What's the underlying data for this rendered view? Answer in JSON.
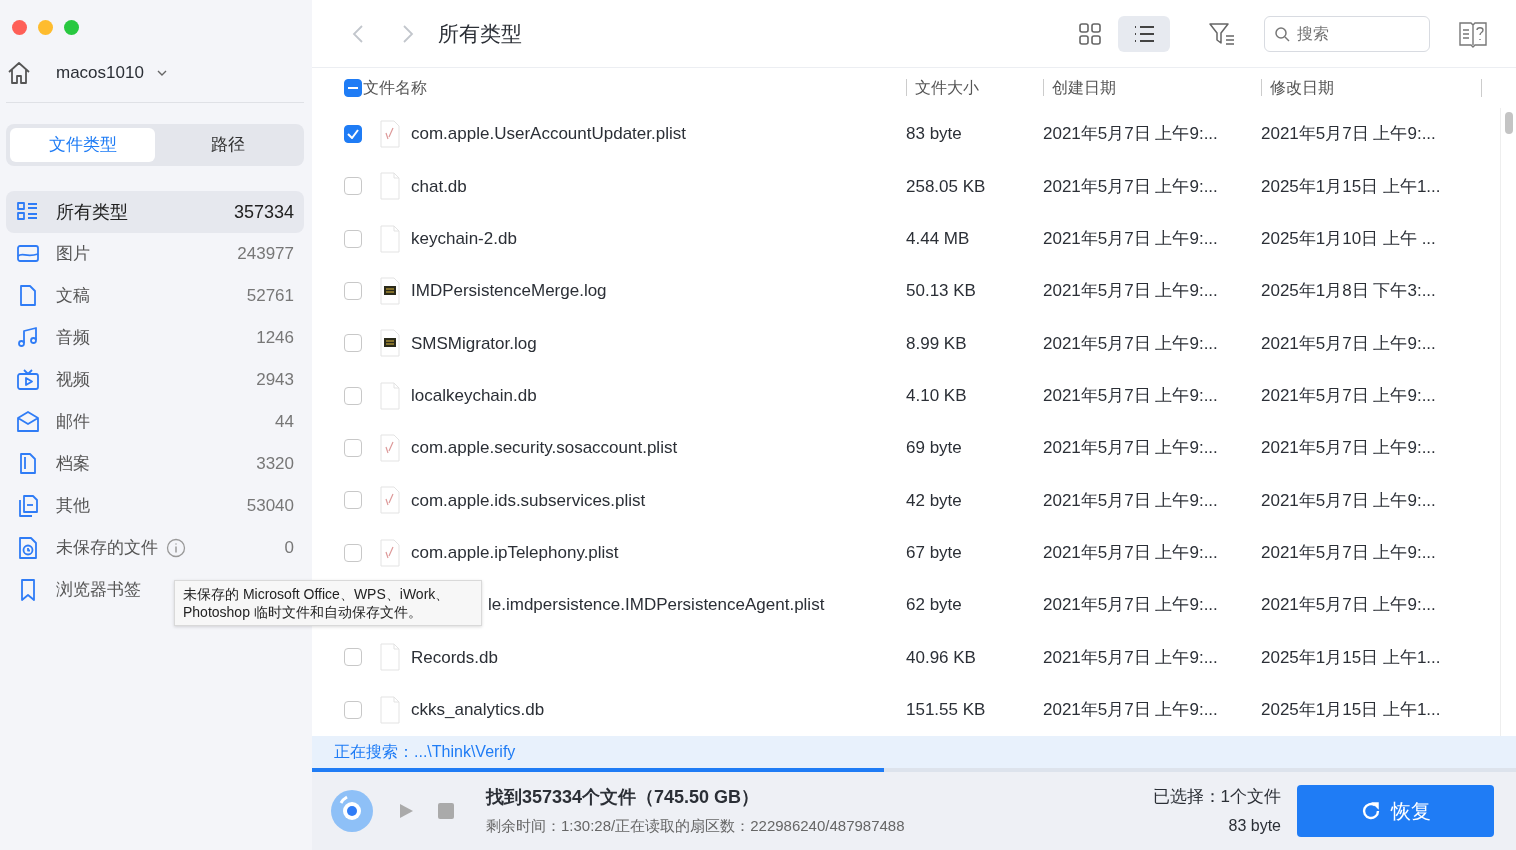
{
  "sidebar": {
    "device": "macos1010",
    "tabs": [
      {
        "label": "文件类型",
        "selected": true
      },
      {
        "label": "路径",
        "selected": false
      }
    ],
    "categories": [
      {
        "kind": "all",
        "label": "所有类型",
        "count": "357334",
        "selected": true
      },
      {
        "kind": "image",
        "label": "图片",
        "count": "243977",
        "selected": false
      },
      {
        "kind": "doc",
        "label": "文稿",
        "count": "52761",
        "selected": false
      },
      {
        "kind": "audio",
        "label": "音频",
        "count": "1246",
        "selected": false
      },
      {
        "kind": "video",
        "label": "视频",
        "count": "2943",
        "selected": false
      },
      {
        "kind": "mail",
        "label": "邮件",
        "count": "44",
        "selected": false
      },
      {
        "kind": "archive",
        "label": "档案",
        "count": "3320",
        "selected": false
      },
      {
        "kind": "other",
        "label": "其他",
        "count": "53040",
        "selected": false
      },
      {
        "kind": "unsaved",
        "label": "未保存的文件",
        "count": "0",
        "selected": false,
        "info": true
      },
      {
        "kind": "bookmark",
        "label": "浏览器书签",
        "selected": false
      }
    ],
    "tooltip": "未保存的 Microsoft Office、WPS、iWork、Photoshop 临时文件和自动保存文件。"
  },
  "toolbar": {
    "title": "所有类型",
    "views": [
      {
        "kind": "grid",
        "selected": false
      },
      {
        "kind": "list",
        "selected": true
      }
    ],
    "search": {
      "placeholder": "搜索"
    }
  },
  "table": {
    "select_all": {
      "indeterminate": true
    },
    "columns": [
      "文件名称",
      "文件大小",
      "创建日期",
      "修改日期"
    ],
    "rows": [
      {
        "checked": true,
        "kind": "plist",
        "name": "com.apple.UserAccountUpdater.plist",
        "size": "83 byte",
        "created": "2021年5月7日 上午9:...",
        "modified": "2021年5月7日 上午9:..."
      },
      {
        "checked": false,
        "kind": "blank",
        "name": "chat.db",
        "size": "258.05 KB",
        "created": "2021年5月7日 上午9:...",
        "modified": "2025年1月15日 上午1..."
      },
      {
        "checked": false,
        "kind": "blank",
        "name": "keychain-2.db",
        "size": "4.44 MB",
        "created": "2021年5月7日 上午9:...",
        "modified": "2025年1月10日 上午 ..."
      },
      {
        "checked": false,
        "kind": "log",
        "name": "IMDPersistenceMerge.log",
        "size": "50.13 KB",
        "created": "2021年5月7日 上午9:...",
        "modified": "2025年1月8日 下午3:..."
      },
      {
        "checked": false,
        "kind": "log",
        "name": "SMSMigrator.log",
        "size": "8.99 KB",
        "created": "2021年5月7日 上午9:...",
        "modified": "2021年5月7日 上午9:..."
      },
      {
        "checked": false,
        "kind": "blank",
        "name": "localkeychain.db",
        "size": "4.10 KB",
        "created": "2021年5月7日 上午9:...",
        "modified": "2021年5月7日 上午9:..."
      },
      {
        "checked": false,
        "kind": "plist",
        "name": "com.apple.security.sosaccount.plist",
        "size": "69 byte",
        "created": "2021年5月7日 上午9:...",
        "modified": "2021年5月7日 上午9:..."
      },
      {
        "checked": false,
        "kind": "plist",
        "name": "com.apple.ids.subservices.plist",
        "size": "42 byte",
        "created": "2021年5月7日 上午9:...",
        "modified": "2021年5月7日 上午9:..."
      },
      {
        "checked": false,
        "kind": "plist",
        "name": "com.apple.ipTelephony.plist",
        "size": "67 byte",
        "created": "2021年5月7日 上午9:...",
        "modified": "2021年5月7日 上午9:..."
      },
      {
        "obscured": true,
        "name": "le.imdpersistence.IMDPersistenceAgent.plist",
        "size": "62 byte",
        "created": "2021年5月7日 上午9:...",
        "modified": "2021年5月7日 上午9:..."
      },
      {
        "checked": false,
        "kind": "blank",
        "name": "Records.db",
        "size": "40.96 KB",
        "created": "2021年5月7日 上午9:...",
        "modified": "2025年1月15日 上午1..."
      },
      {
        "checked": false,
        "kind": "blank",
        "name": "ckks_analytics.db",
        "size": "151.55 KB",
        "created": "2021年5月7日 上午9:...",
        "modified": "2025年1月15日 上午1..."
      }
    ]
  },
  "search_status": "正在搜索：...\\Think\\Verify",
  "progress": {
    "level": 0.475
  },
  "footer": {
    "found": "找到357334个文件（745.50 GB）",
    "detail": "剩余时间：1:30:28/正在读取的扇区数：222986240/487987488",
    "selected": "已选择：1个文件",
    "selected_size": "83 byte",
    "recover_button": "恢复"
  }
}
